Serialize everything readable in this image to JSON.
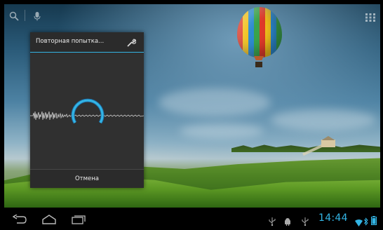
{
  "top_bar": {
    "search_icon": "search-icon",
    "voice_icon": "microphone-icon",
    "apps_icon": "all-apps-icon"
  },
  "voice_dialog": {
    "title": "Повторная попытка...",
    "settings_icon": "wrench-icon",
    "accent_color": "#33b5e5",
    "cancel_label": "Отмена"
  },
  "system_bar": {
    "back_icon": "back-icon",
    "home_icon": "home-icon",
    "recents_icon": "recent-apps-icon",
    "notification_icons": [
      "usb-icon",
      "android-debug-icon",
      "usb-icon"
    ],
    "time": "14:44",
    "status_icons": [
      "wifi-icon",
      "bluetooth-icon",
      "battery-icon"
    ],
    "clock_color": "#33b5e5"
  }
}
